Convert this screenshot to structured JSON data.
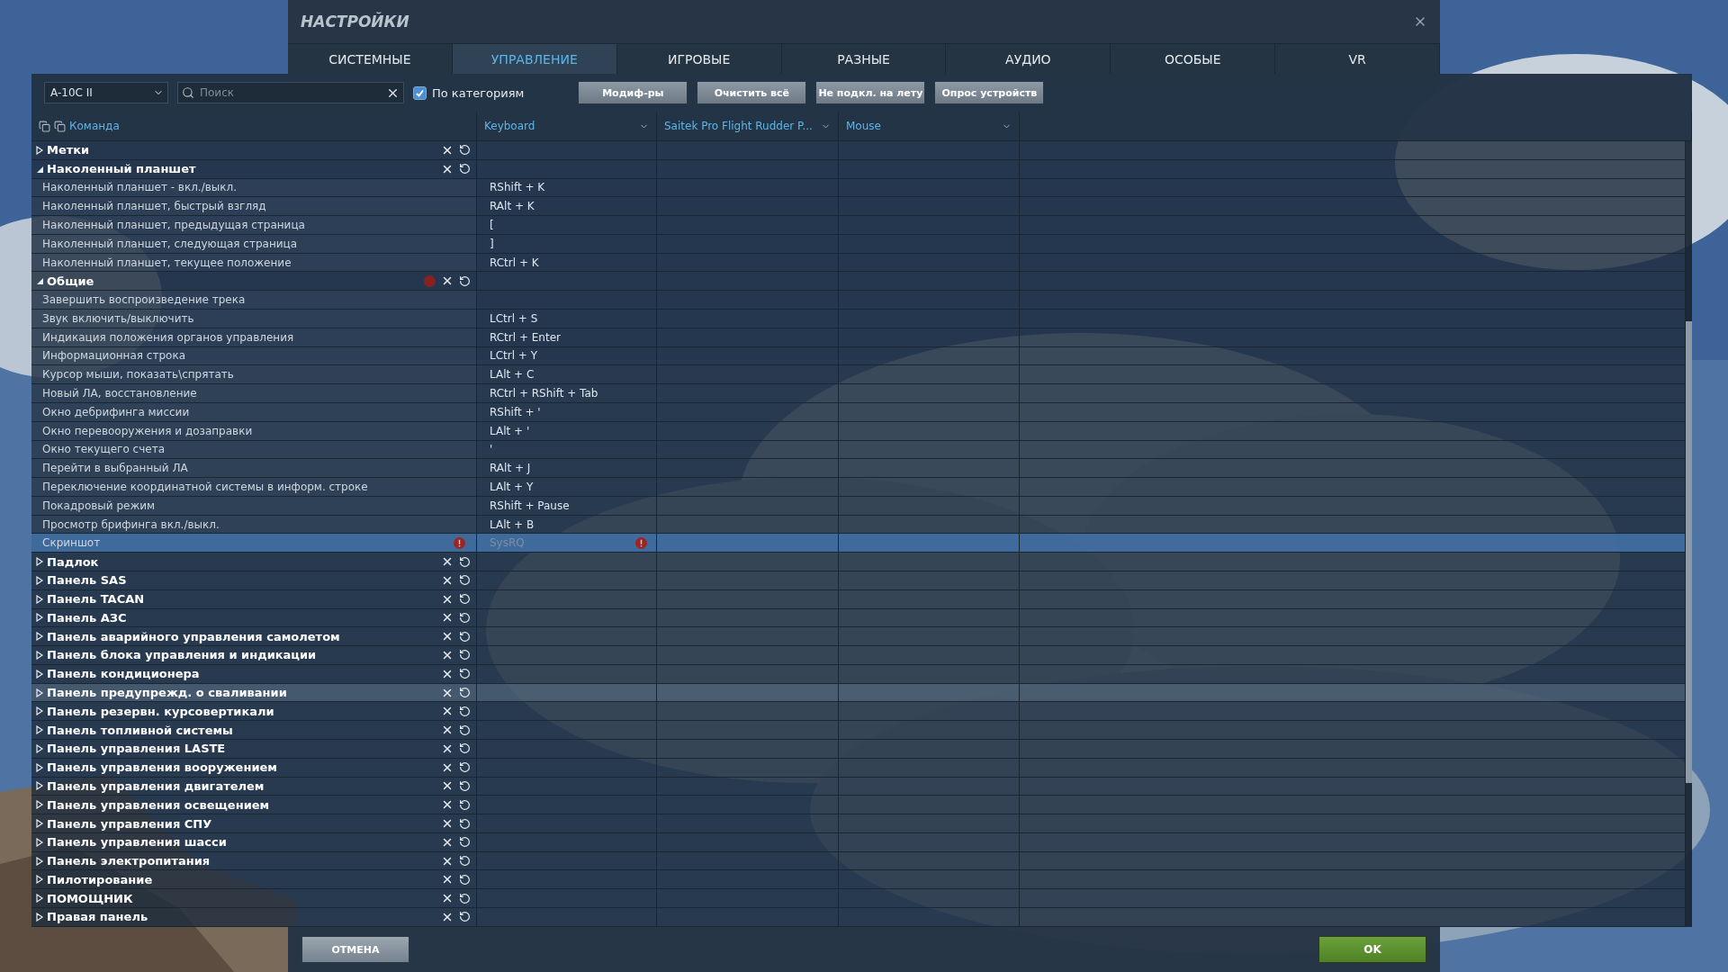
{
  "window": {
    "title": "НАСТРОЙКИ"
  },
  "tabs": [
    {
      "label": "СИСТЕМНЫЕ",
      "selected": false
    },
    {
      "label": "УПРАВЛЕНИЕ",
      "selected": true
    },
    {
      "label": "ИГРОВЫЕ",
      "selected": false
    },
    {
      "label": "РАЗНЫЕ",
      "selected": false
    },
    {
      "label": "АУДИО",
      "selected": false
    },
    {
      "label": "ОСОБЫЕ",
      "selected": false
    },
    {
      "label": "VR",
      "selected": false
    }
  ],
  "toolbar": {
    "aircraft": "A-10C II",
    "search": {
      "placeholder": "Поиск"
    },
    "by_category": {
      "label": "По категориям",
      "checked": true
    },
    "buttons": [
      "Модиф-ры",
      "Очистить всё",
      "Не подкл. на лету",
      "Опрос устройств"
    ]
  },
  "table": {
    "command_header": "Команда",
    "columns": [
      "Keyboard",
      "Saitek Pro Flight Rudder P...",
      "Mouse"
    ],
    "rows": [
      {
        "kind": "group",
        "name": "Метки",
        "expanded": false,
        "conflict": false,
        "highlighted": false
      },
      {
        "kind": "group",
        "name": "Наколенный планшет",
        "expanded": true,
        "conflict": false,
        "highlighted": false
      },
      {
        "kind": "command",
        "name": "Наколенный планшет - вкл./выкл.",
        "keyboard": "RShift + K",
        "selected": false,
        "conflict": false
      },
      {
        "kind": "command",
        "name": "Наколенный планшет, быстрый взгляд",
        "keyboard": "RAlt + K",
        "selected": false,
        "conflict": false
      },
      {
        "kind": "command",
        "name": "Наколенный планшет, предыдущая страница",
        "keyboard": "[",
        "selected": false,
        "conflict": false
      },
      {
        "kind": "command",
        "name": "Наколенный планшет, следующая страница",
        "keyboard": "]",
        "selected": false,
        "conflict": false
      },
      {
        "kind": "command",
        "name": "Наколенный планшет, текущее положение",
        "keyboard": "RCtrl + K",
        "selected": false,
        "conflict": false
      },
      {
        "kind": "group",
        "name": "Общие",
        "expanded": true,
        "conflict": true,
        "highlighted": false
      },
      {
        "kind": "command",
        "name": "Завершить воспроизведение трека",
        "selected": false,
        "conflict": false
      },
      {
        "kind": "command",
        "name": "Звук включить/выключить",
        "keyboard": "LCtrl + S",
        "selected": false,
        "conflict": false
      },
      {
        "kind": "command",
        "name": "Индикация положения органов управления",
        "keyboard": "RCtrl + Enter",
        "selected": false,
        "conflict": false
      },
      {
        "kind": "command",
        "name": "Информационная строка",
        "keyboard": "LCtrl + Y",
        "selected": false,
        "conflict": false
      },
      {
        "kind": "command",
        "name": "Курсор мыши, показать\\спрятать",
        "keyboard": "LAlt + C",
        "selected": false,
        "conflict": false
      },
      {
        "kind": "command",
        "name": "Новый ЛА, восстановление",
        "keyboard": "RCtrl + RShift + Tab",
        "selected": false,
        "conflict": false
      },
      {
        "kind": "command",
        "name": "Окно дебрифинга миссии",
        "keyboard": "RShift + '",
        "selected": false,
        "conflict": false
      },
      {
        "kind": "command",
        "name": "Окно перевооружения и дозаправки",
        "keyboard": "LAlt + '",
        "selected": false,
        "conflict": false
      },
      {
        "kind": "command",
        "name": "Окно текущего счета",
        "keyboard": "'",
        "selected": false,
        "conflict": false
      },
      {
        "kind": "command",
        "name": "Перейти в выбранный ЛА",
        "keyboard": "RAlt + J",
        "selected": false,
        "conflict": false
      },
      {
        "kind": "command",
        "name": "Переключение координатной системы в информ. строке",
        "keyboard": "LAlt + Y",
        "selected": false,
        "conflict": false
      },
      {
        "kind": "command",
        "name": "Покадровый режим",
        "keyboard": "RShift + Pause",
        "selected": false,
        "conflict": false
      },
      {
        "kind": "command",
        "name": "Просмотр брифинга вкл./выкл.",
        "keyboard": "LAlt + B",
        "selected": false,
        "conflict": false
      },
      {
        "kind": "command",
        "name": "Скриншот",
        "keyboard": "SysRQ",
        "selected": true,
        "conflict": true
      },
      {
        "kind": "group",
        "name": "Падлок",
        "expanded": false,
        "conflict": false,
        "highlighted": false
      },
      {
        "kind": "group",
        "name": "Панель SAS",
        "expanded": false,
        "conflict": false,
        "highlighted": false
      },
      {
        "kind": "group",
        "name": "Панель TACAN",
        "expanded": false,
        "conflict": false,
        "highlighted": false
      },
      {
        "kind": "group",
        "name": "Панель АЗС",
        "expanded": false,
        "conflict": false,
        "highlighted": false
      },
      {
        "kind": "group",
        "name": "Панель аварийного управления самолетом",
        "expanded": false,
        "conflict": false,
        "highlighted": false
      },
      {
        "kind": "group",
        "name": "Панель блока управления и индикации",
        "expanded": false,
        "conflict": false,
        "highlighted": false
      },
      {
        "kind": "group",
        "name": "Панель кондиционера",
        "expanded": false,
        "conflict": false,
        "highlighted": false
      },
      {
        "kind": "group",
        "name": "Панель предупрежд. о сваливании",
        "expanded": false,
        "conflict": false,
        "highlighted": true
      },
      {
        "kind": "group",
        "name": "Панель резервн. курсовертикали",
        "expanded": false,
        "conflict": false,
        "highlighted": false
      },
      {
        "kind": "group",
        "name": "Панель топливной системы",
        "expanded": false,
        "conflict": false,
        "highlighted": false
      },
      {
        "kind": "group",
        "name": "Панель управления LASTE",
        "expanded": false,
        "conflict": false,
        "highlighted": false
      },
      {
        "kind": "group",
        "name": "Панель управления вооружением",
        "expanded": false,
        "conflict": false,
        "highlighted": false
      },
      {
        "kind": "group",
        "name": "Панель управления двигателем",
        "expanded": false,
        "conflict": false,
        "highlighted": false
      },
      {
        "kind": "group",
        "name": "Панель управления освещением",
        "expanded": false,
        "conflict": false,
        "highlighted": false
      },
      {
        "kind": "group",
        "name": "Панель управления СПУ",
        "expanded": false,
        "conflict": false,
        "highlighted": false
      },
      {
        "kind": "group",
        "name": "Панель управления шасси",
        "expanded": false,
        "conflict": false,
        "highlighted": false
      },
      {
        "kind": "group",
        "name": "Панель электропитания",
        "expanded": false,
        "conflict": false,
        "highlighted": false
      },
      {
        "kind": "group",
        "name": "Пилотирование",
        "expanded": false,
        "conflict": false,
        "highlighted": false
      },
      {
        "kind": "group",
        "name": "ПОМОЩНИК",
        "expanded": false,
        "conflict": false,
        "highlighted": false
      },
      {
        "kind": "group",
        "name": "Правая панель",
        "expanded": false,
        "conflict": false,
        "highlighted": false
      }
    ]
  },
  "footer": {
    "cancel": "ОТМЕНА",
    "ok": "OK"
  }
}
